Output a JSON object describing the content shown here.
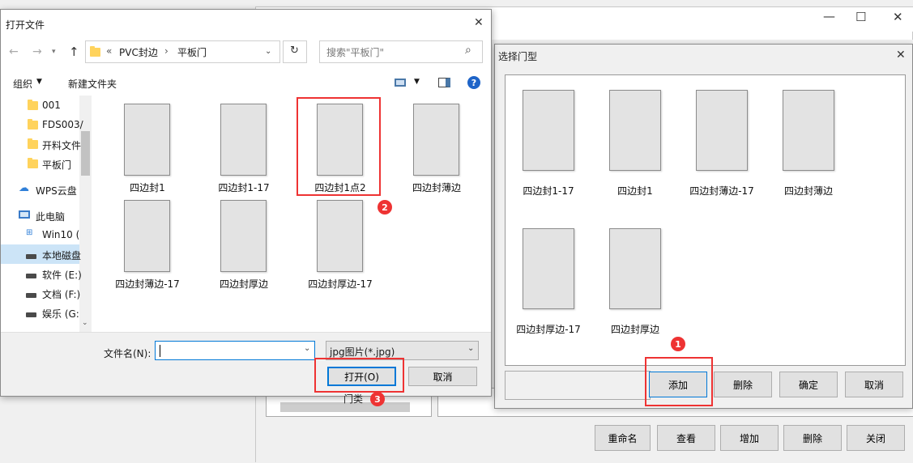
{
  "back_window": {
    "buttons": [
      "重命名",
      "查看",
      "增加",
      "删除",
      "关闭"
    ]
  },
  "select_dialog": {
    "title": "选择门型",
    "items": [
      "四边封1-17",
      "四边封1",
      "四边封薄边-17",
      "四边封薄边",
      "四边封厚边-17",
      "四边封厚边"
    ],
    "buttons": {
      "add": "添加",
      "delete": "删除",
      "ok": "确定",
      "cancel": "取消"
    }
  },
  "open_dialog": {
    "title": "打开文件",
    "breadcrumb": {
      "prefix": "«",
      "items": [
        "PVC封边",
        "平板门"
      ]
    },
    "search_placeholder": "搜索\"平板门\"",
    "toolbar": {
      "organize": "组织",
      "new_folder": "新建文件夹"
    },
    "nav_items": [
      "001",
      "FDS003/",
      "开料文件",
      "平板门",
      "WPS云盘",
      "此电脑",
      "Win10 (",
      "本地磁盘",
      "软件 (E:)",
      "文档 (F:)",
      "娱乐 (G:"
    ],
    "files": [
      "四边封1",
      "四边封1-17",
      "四边封1点2",
      "四边封薄边",
      "四边封薄边-17",
      "四边封厚边",
      "四边封厚边-17"
    ],
    "filename_label": "文件名(N):",
    "filename_value": "",
    "file_type": "jpg图片(*.jpg)",
    "open_button": "打开(O)",
    "cancel_button": "取消",
    "partial_label": "门类型"
  },
  "annotations": [
    "1",
    "2",
    "3"
  ],
  "colors": {
    "accent": "#0078d7",
    "annotation": "#ee3333",
    "help": "#1e64c8"
  }
}
